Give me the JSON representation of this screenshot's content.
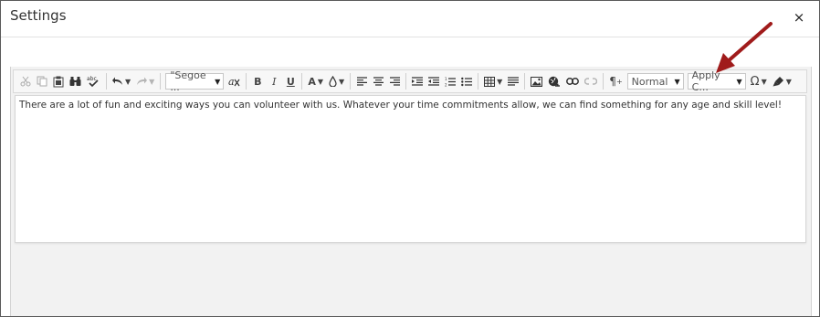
{
  "dialog": {
    "title": "Settings",
    "close_label": "×"
  },
  "toolbar": {
    "font_family": "\"Segoe ...",
    "format_block": "Normal",
    "apply_css": "Apply C...",
    "bold": "B",
    "italic": "I",
    "underline": "U",
    "font_color": "A",
    "special_char": "Ω"
  },
  "editor": {
    "content": "There are a lot of fun and exciting ways you can volunteer with us. Whatever your time commitments allow, we can find something for any age and skill level!"
  },
  "annotation": {
    "arrow_color": "#a01b1b"
  }
}
